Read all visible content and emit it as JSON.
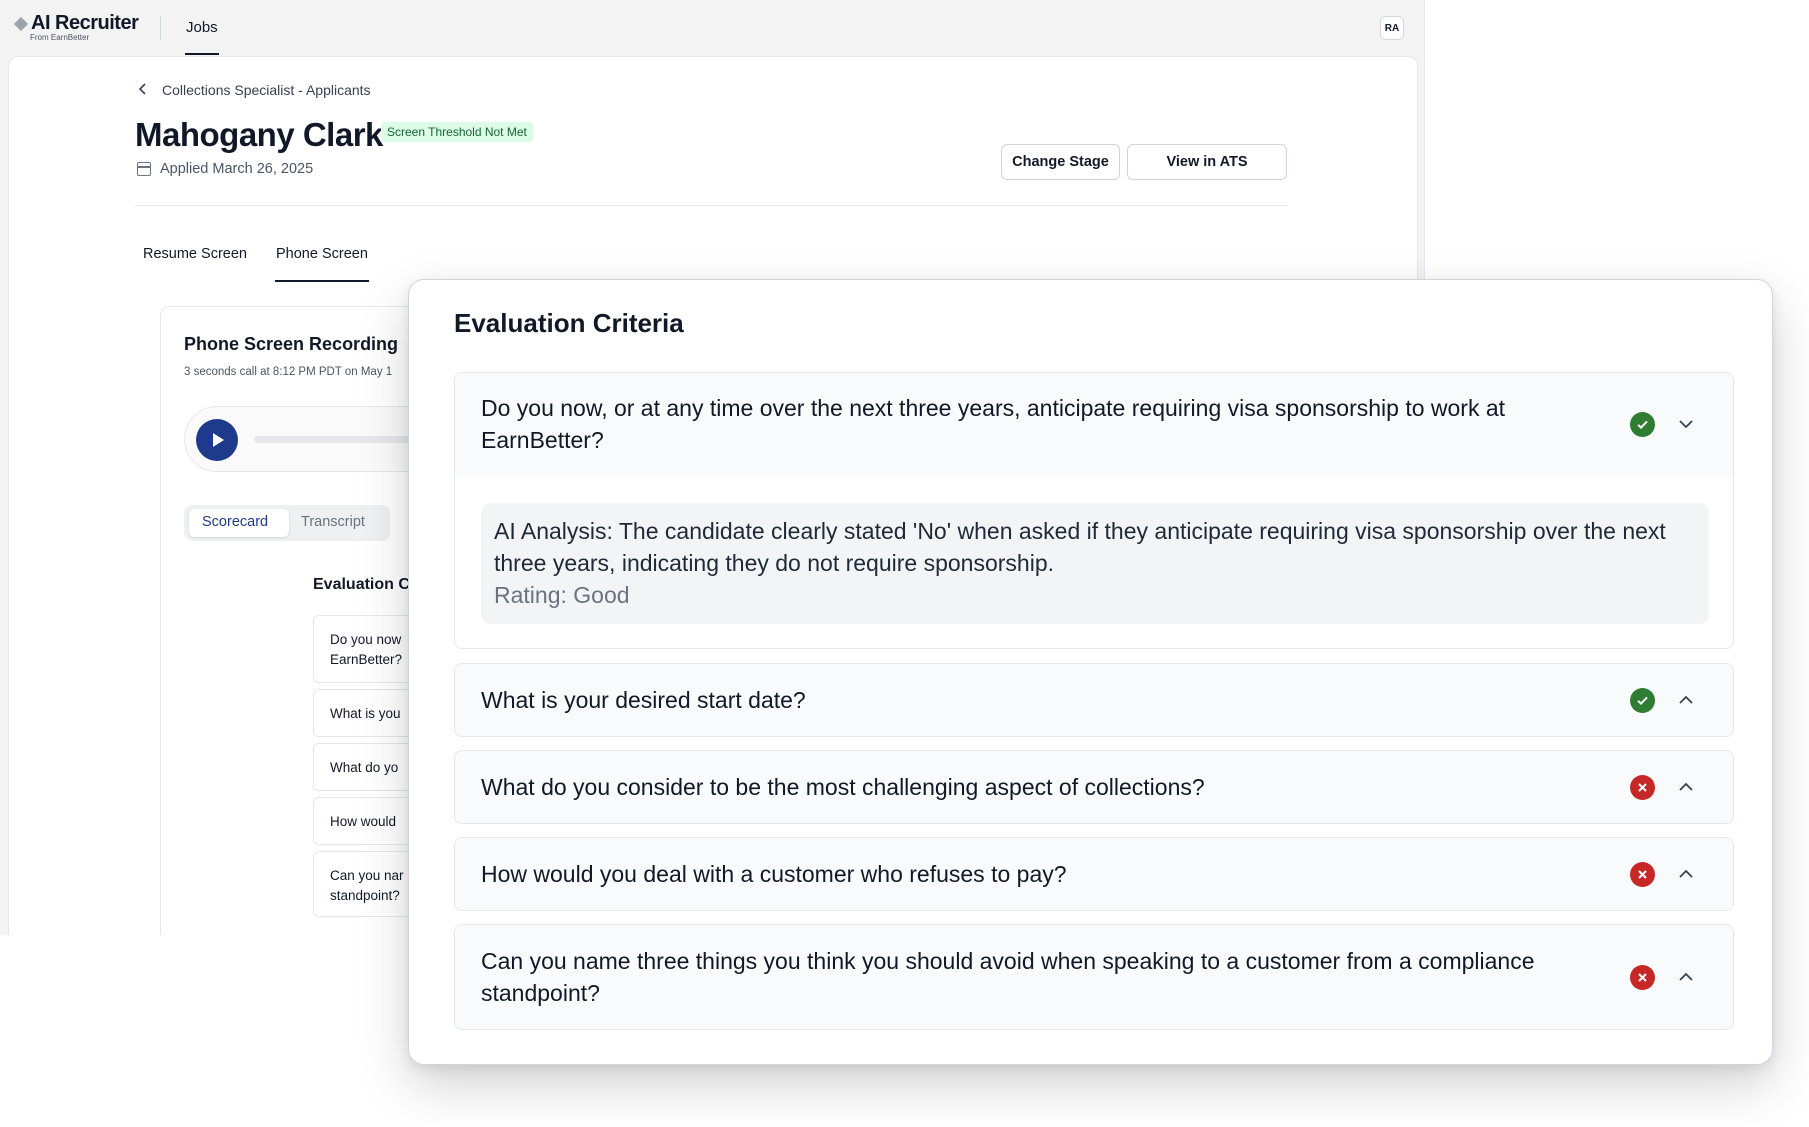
{
  "app": {
    "logo_main": "AI Recruiter",
    "logo_sub": "From EarnBetter",
    "nav_jobs": "Jobs",
    "avatar_initials": "RA"
  },
  "header": {
    "breadcrumb": "Collections Specialist - Applicants",
    "candidate_name": "Mahogany Clark",
    "status_badge": "Screen Threshold Not Met",
    "applied_date": "Applied March 26, 2025",
    "change_stage_label": "Change Stage",
    "view_ats_label": "View in ATS"
  },
  "tabs": [
    {
      "label": "Resume Screen",
      "active": false
    },
    {
      "label": "Phone Screen",
      "active": true
    }
  ],
  "recording": {
    "title": "Phone Screen Recording",
    "subtitle": "3 seconds call at 8:12 PM PDT on May 1",
    "segment_scorecard": "Scorecard",
    "segment_transcript": "Transcript",
    "eval_title": "Evaluation C",
    "items": [
      "Do you now\nEarnBetter?",
      "What is you",
      "What do yo",
      "How would",
      "Can you nar\nstandpoint?"
    ]
  },
  "modal": {
    "title": "Evaluation Criteria",
    "criteria": [
      {
        "question": "Do you now, or at any time over the next three years, anticipate requiring visa sponsorship to work at EarnBetter?",
        "status": "pass",
        "expanded": true,
        "analysis_label": "AI Analysis:",
        "analysis_text": "The candidate clearly stated 'No' when asked if they anticipate requiring visa sponsorship over the next three years, indicating they do not require sponsorship.",
        "rating": "Rating: Good"
      },
      {
        "question": "What is your desired start date?",
        "status": "pass",
        "expanded": false
      },
      {
        "question": "What do you consider to be the most challenging aspect of collections?",
        "status": "fail",
        "expanded": false
      },
      {
        "question": "How would you deal with a customer who refuses to pay?",
        "status": "fail",
        "expanded": false
      },
      {
        "question": "Can you name three things you think you should avoid when speaking to a customer from a compliance standpoint?",
        "status": "fail",
        "expanded": false
      }
    ]
  },
  "colors": {
    "pass": "#2e7d32",
    "fail": "#c62828",
    "accent": "#1e3a8a",
    "badge_bg": "#dcfce7",
    "badge_text": "#166534"
  }
}
